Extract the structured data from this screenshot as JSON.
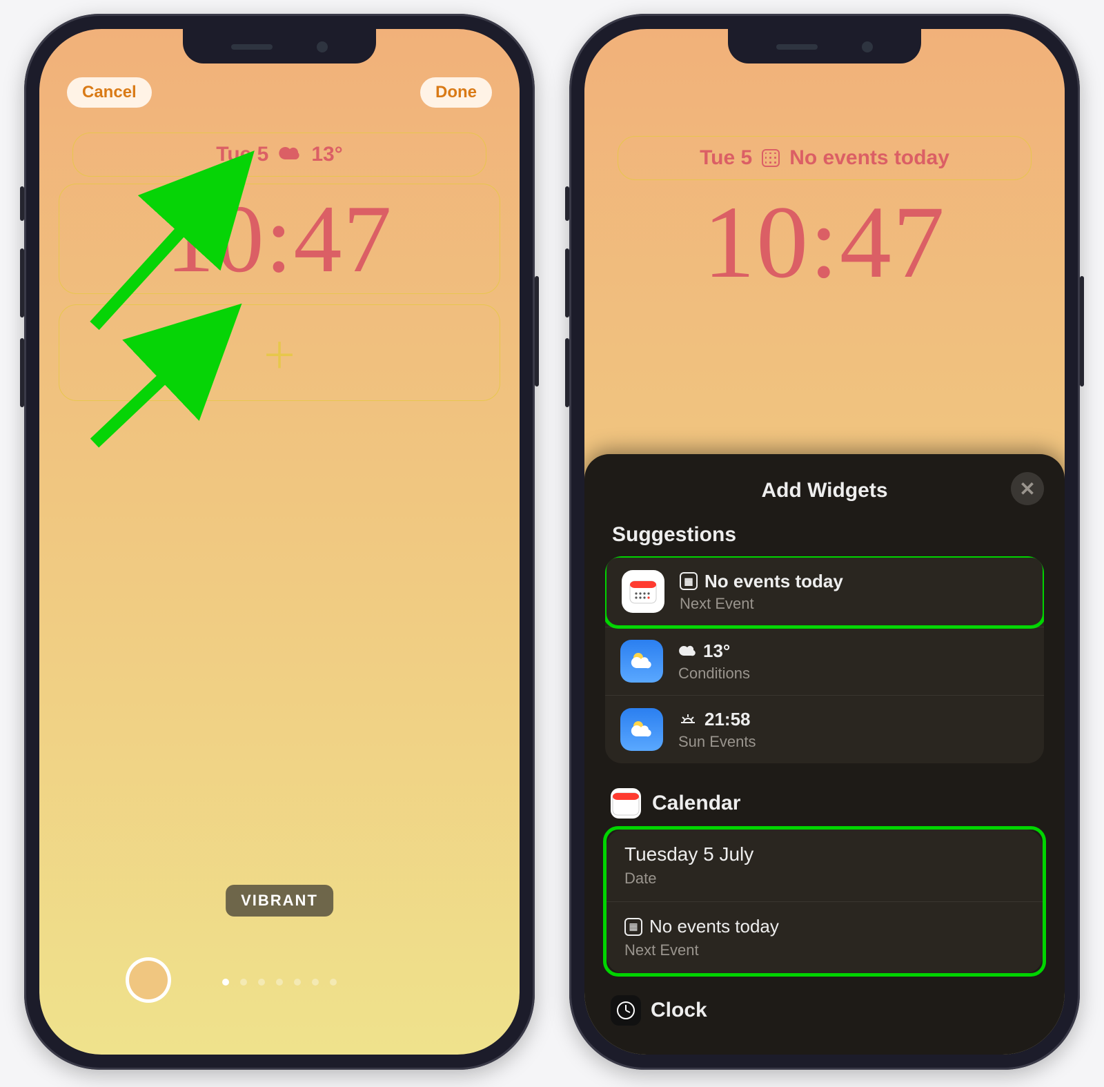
{
  "left": {
    "cancel": "Cancel",
    "done": "Done",
    "date": "Tue 5",
    "temp": "13°",
    "time": "10:47",
    "filter_label": "VIBRANT",
    "page_dot_count": 7,
    "page_dot_active": 0
  },
  "right": {
    "date": "Tue 5",
    "cal_text": "No events today",
    "time": "10:47",
    "sheet": {
      "title": "Add Widgets",
      "suggestions_heading": "Suggestions",
      "suggestions": [
        {
          "app": "Calendar",
          "line1": "No events today",
          "line2": "Next Event"
        },
        {
          "app": "Weather",
          "line1": "13°",
          "line2": "Conditions"
        },
        {
          "app": "Weather",
          "line1": "21:58",
          "line2": "Sun Events"
        }
      ],
      "calendar_heading": "Calendar",
      "calendar_rows": [
        {
          "line1": "Tuesday 5 July",
          "line2": "Date"
        },
        {
          "line1": "No events today",
          "line2": "Next Event",
          "has_glyph": true
        }
      ],
      "clock_heading": "Clock"
    }
  }
}
